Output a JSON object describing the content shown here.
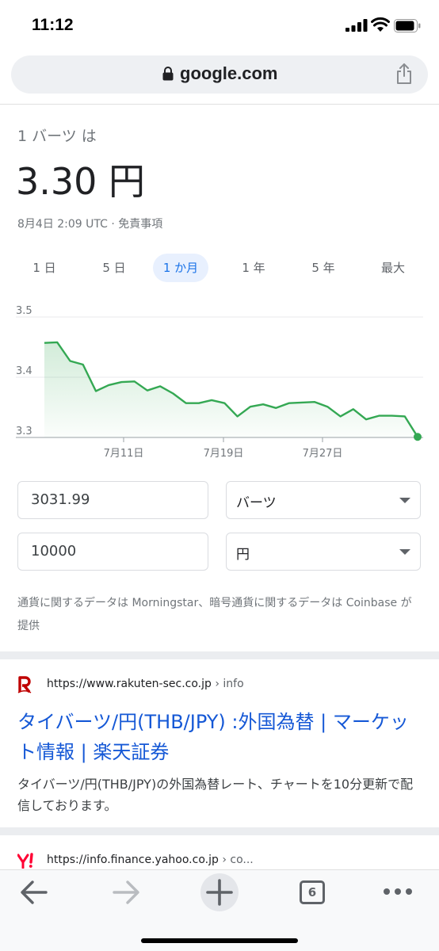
{
  "status_bar": {
    "time": "11:12"
  },
  "url_bar": {
    "domain": "google.com"
  },
  "converter": {
    "from_label": "1 バーツ は",
    "rate": "3.30 円",
    "meta": "8月4日 2:09 UTC · 免責事項",
    "tabs": [
      {
        "label": "1 日",
        "active": false
      },
      {
        "label": "5 日",
        "active": false
      },
      {
        "label": "1 か月",
        "active": true
      },
      {
        "label": "1 年",
        "active": false
      },
      {
        "label": "5 年",
        "active": false
      },
      {
        "label": "最大",
        "active": false
      }
    ],
    "amount_from": "3031.99",
    "currency_from": "バーツ",
    "amount_to": "10000",
    "currency_to": "円",
    "source_note": "通貨に関するデータは Morningstar、暗号通貨に関するデータは Coinbase が提供"
  },
  "chart_data": {
    "type": "area",
    "x_tick_labels": [
      "7月11日",
      "7月19日",
      "7月27日"
    ],
    "y_tick_labels": [
      "3.5",
      "3.4",
      "3.3"
    ],
    "ylim": [
      3.3,
      3.5
    ],
    "color": "#34a853",
    "values": [
      3.457,
      3.458,
      3.427,
      3.421,
      3.377,
      3.387,
      3.392,
      3.393,
      3.378,
      3.385,
      3.373,
      3.357,
      3.357,
      3.362,
      3.357,
      3.335,
      3.351,
      3.355,
      3.349,
      3.357,
      3.358,
      3.359,
      3.351,
      3.335,
      3.347,
      3.33,
      3.336,
      3.336,
      3.335,
      3.301
    ]
  },
  "results": [
    {
      "url": "https://www.rakuten-sec.co.jp",
      "crumb": " › info",
      "title": "タイバーツ/円(THB/JPY) :外国為替 | マーケット情報 | 楽天証券",
      "snippet": "タイバーツ/円(THB/JPY)の外国為替レート、チャートを10分更新で配信しております。"
    },
    {
      "url": "https://info.finance.yahoo.co.jp",
      "crumb": " › co..."
    }
  ],
  "toolbar": {
    "tab_count": "6"
  }
}
